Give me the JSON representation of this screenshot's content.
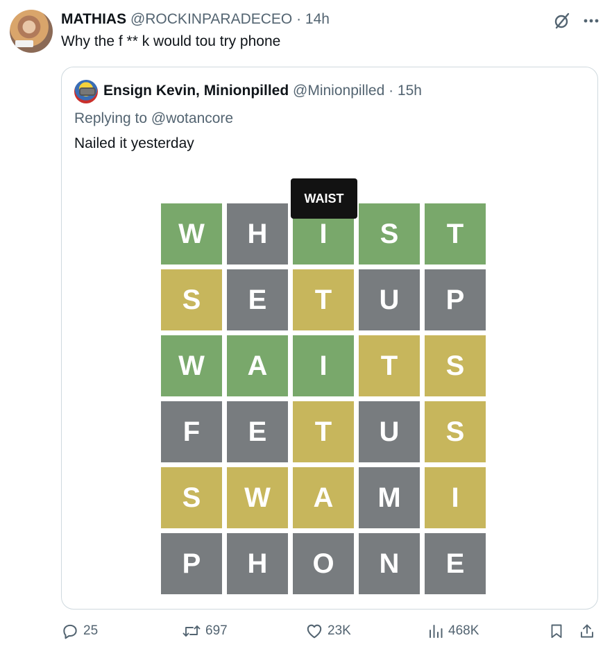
{
  "tweet": {
    "author_name": "MATHIAS",
    "author_handle": "@ROCKINPARADECEO",
    "time": "· 14h",
    "text": "Why the f ** k would tou try phone"
  },
  "quote": {
    "author_name": "Ensign Kevin, Minionpilled",
    "author_handle": "@Minionpilled",
    "time": "· 15h",
    "replying_to": "Replying to @wotancore",
    "text": "Nailed it yesterday",
    "tooltip": "WAIST",
    "wordle": {
      "rows": [
        {
          "letters": [
            "W",
            "H",
            "I",
            "S",
            "T"
          ],
          "states": [
            "g",
            "x",
            "g",
            "g",
            "g"
          ]
        },
        {
          "letters": [
            "S",
            "E",
            "T",
            "U",
            "P"
          ],
          "states": [
            "y",
            "x",
            "y",
            "x",
            "x"
          ]
        },
        {
          "letters": [
            "W",
            "A",
            "I",
            "T",
            "S"
          ],
          "states": [
            "g",
            "g",
            "g",
            "y",
            "y"
          ]
        },
        {
          "letters": [
            "F",
            "E",
            "T",
            "U",
            "S"
          ],
          "states": [
            "x",
            "x",
            "y",
            "x",
            "y"
          ]
        },
        {
          "letters": [
            "S",
            "W",
            "A",
            "M",
            "I"
          ],
          "states": [
            "y",
            "y",
            "y",
            "x",
            "y"
          ]
        },
        {
          "letters": [
            "P",
            "H",
            "O",
            "N",
            "E"
          ],
          "states": [
            "x",
            "x",
            "x",
            "x",
            "x"
          ]
        }
      ],
      "colors": {
        "green": "#79a86b",
        "yellow": "#c7b65c",
        "gray": "#787c7f"
      }
    }
  },
  "actions": {
    "replies": "25",
    "retweets": "697",
    "likes": "23K",
    "views": "468K"
  },
  "icons": {
    "grok": "grok-slash-icon",
    "more": "more-icon",
    "reply": "reply-icon",
    "retweet": "retweet-icon",
    "like": "heart-icon",
    "views": "views-icon",
    "bookmark": "bookmark-icon",
    "share": "share-icon"
  }
}
